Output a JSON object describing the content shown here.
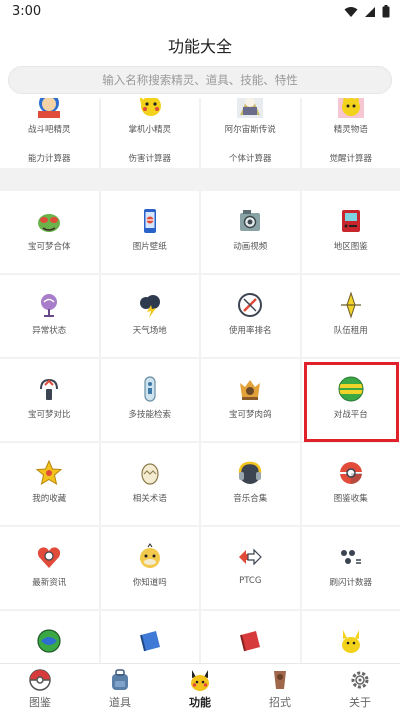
{
  "status": {
    "time": "3:00"
  },
  "appbar": {
    "title": "功能大全"
  },
  "search": {
    "placeholder": "输入名称搜索精灵、道具、技能、特性"
  },
  "top_items": [
    {
      "label": "战斗吧精灵"
    },
    {
      "label": "掌机小精灵"
    },
    {
      "label": "阿尔宙斯传说"
    },
    {
      "label": "精灵物语"
    }
  ],
  "calc_items": [
    {
      "label": "能力计算器"
    },
    {
      "label": "伤害计算器"
    },
    {
      "label": "个体计算器"
    },
    {
      "label": "觉醒计算器"
    }
  ],
  "grid": [
    {
      "label": "宝可梦合体",
      "icon": "pokemon-fusion-icon"
    },
    {
      "label": "图片壁纸",
      "icon": "phone-wallpaper-icon"
    },
    {
      "label": "动画视频",
      "icon": "camera-video-icon"
    },
    {
      "label": "地区图鉴",
      "icon": "region-pokedex-icon"
    },
    {
      "label": "异常状态",
      "icon": "status-condition-icon"
    },
    {
      "label": "天气场地",
      "icon": "weather-field-icon"
    },
    {
      "label": "使用率排名",
      "icon": "usage-ranking-icon"
    },
    {
      "label": "队伍租用",
      "icon": "team-rental-icon"
    },
    {
      "label": "宝可梦对比",
      "icon": "pokemon-compare-icon"
    },
    {
      "label": "多技能检索",
      "icon": "multi-move-search-icon"
    },
    {
      "label": "宝可梦肉鸽",
      "icon": "pokemon-roguelike-icon"
    },
    {
      "label": "对战平台",
      "icon": "battle-platform-icon"
    },
    {
      "label": "我的收藏",
      "icon": "favorites-star-icon"
    },
    {
      "label": "相关术语",
      "icon": "terminology-egg-icon"
    },
    {
      "label": "音乐合集",
      "icon": "music-collection-icon"
    },
    {
      "label": "图鉴收集",
      "icon": "pokedex-collection-icon"
    },
    {
      "label": "最新资讯",
      "icon": "news-heart-icon"
    },
    {
      "label": "你知道吗",
      "icon": "psyduck-icon"
    },
    {
      "label": "PTCG",
      "icon": "ptcg-cards-icon"
    },
    {
      "label": "刷闪计数器",
      "icon": "shiny-counter-icon"
    },
    {
      "label": "",
      "icon": "map-icon"
    },
    {
      "label": "",
      "icon": "blue-book-icon"
    },
    {
      "label": "",
      "icon": "red-book-icon"
    },
    {
      "label": "",
      "icon": "pikachu-icon"
    }
  ],
  "nav": [
    {
      "label": "图鉴",
      "icon": "pokeball-icon"
    },
    {
      "label": "道具",
      "icon": "backpack-icon"
    },
    {
      "label": "功能",
      "icon": "pikachu-face-icon"
    },
    {
      "label": "招式",
      "icon": "technique-icon"
    },
    {
      "label": "关于",
      "icon": "gear-icon"
    }
  ],
  "colors": {
    "accent_highlight": "#e0202a",
    "battle_icon_green": "#3aa845",
    "battle_icon_yellow": "#f2d32a"
  }
}
